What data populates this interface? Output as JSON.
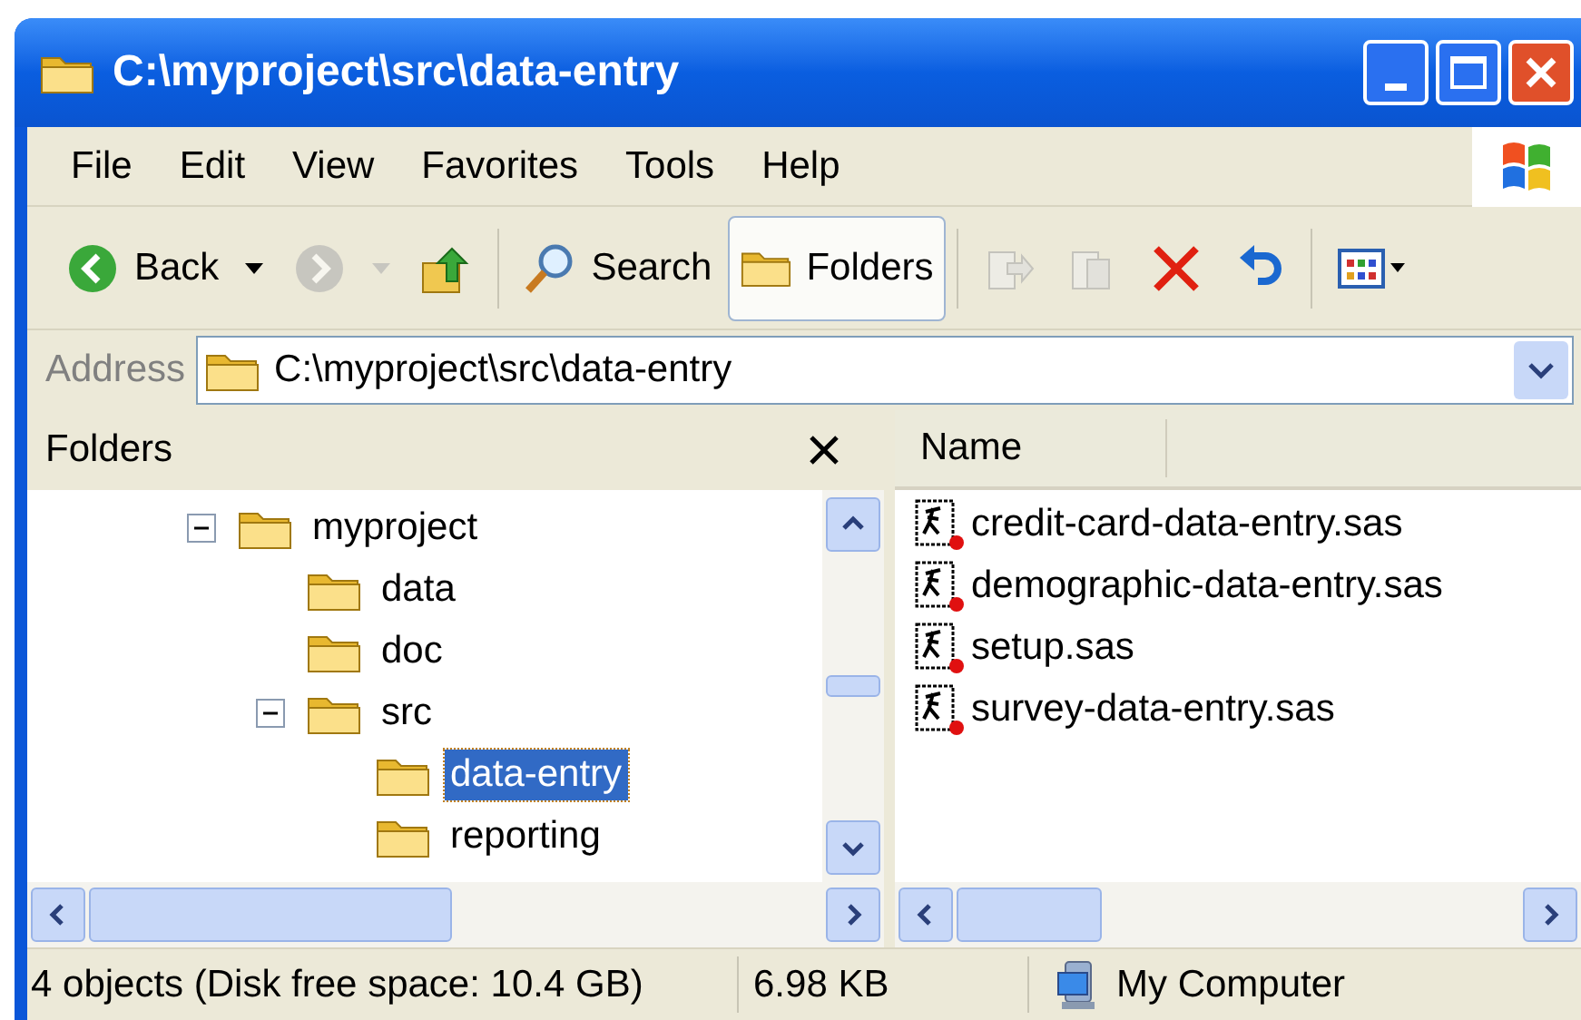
{
  "window": {
    "title": "C:\\myproject\\src\\data-entry"
  },
  "menu": [
    "File",
    "Edit",
    "View",
    "Favorites",
    "Tools",
    "Help"
  ],
  "toolbar": [
    {
      "kind": "back",
      "label": "Back",
      "disabled": false,
      "selected": false
    },
    {
      "kind": "forward",
      "disabled": true,
      "selected": false
    },
    {
      "kind": "up",
      "disabled": false,
      "selected": false
    },
    {
      "kind": "search",
      "label": "Search",
      "disabled": false,
      "selected": false
    },
    {
      "kind": "folders",
      "label": "Folders",
      "disabled": false,
      "selected": true
    },
    {
      "kind": "move",
      "disabled": true,
      "selected": false
    },
    {
      "kind": "copy",
      "disabled": true,
      "selected": false
    },
    {
      "kind": "delete",
      "disabled": false,
      "selected": false
    },
    {
      "kind": "undo",
      "disabled": false,
      "selected": false
    },
    {
      "kind": "views",
      "disabled": false,
      "selected": false
    }
  ],
  "address": {
    "label": "Address",
    "value": "C:\\myproject\\src\\data-entry"
  },
  "folders_pane": {
    "title": "Folders",
    "tree": [
      {
        "label": "myproject",
        "selected": false,
        "expanded": true,
        "children": [
          {
            "label": "data",
            "selected": false
          },
          {
            "label": "doc",
            "selected": false
          },
          {
            "label": "src",
            "selected": false,
            "expanded": true,
            "children": [
              {
                "label": "data-entry",
                "selected": true
              },
              {
                "label": "reporting",
                "selected": false
              }
            ]
          }
        ]
      }
    ]
  },
  "files": {
    "columns": [
      "Name"
    ],
    "items": [
      {
        "name": "credit-card-data-entry.sas"
      },
      {
        "name": "demographic-data-entry.sas"
      },
      {
        "name": "setup.sas"
      },
      {
        "name": "survey-data-entry.sas"
      }
    ]
  },
  "status_bar": [
    "4 objects (Disk free space: 10.4 GB)",
    "6.98 KB",
    "My Computer"
  ]
}
